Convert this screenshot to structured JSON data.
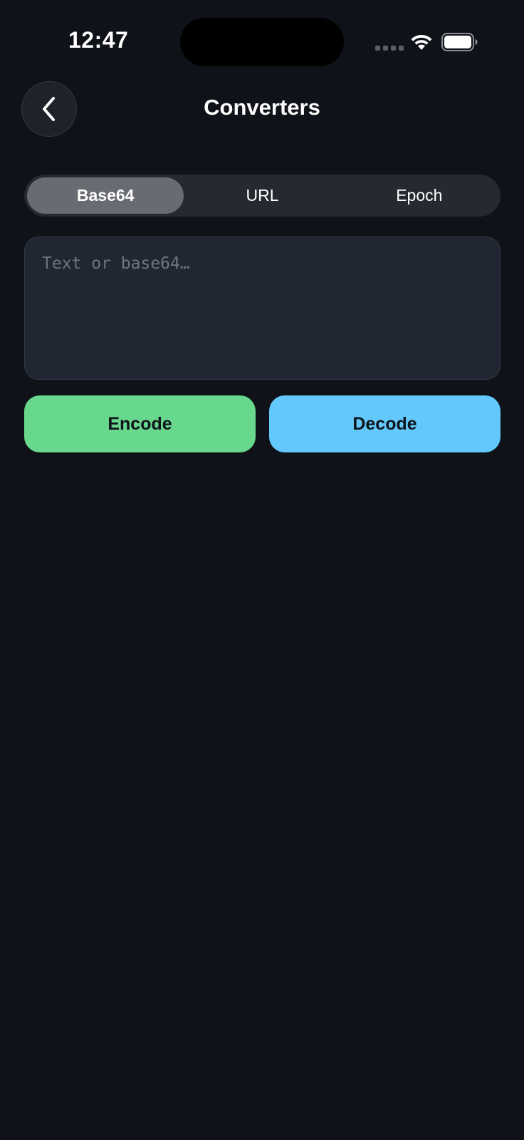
{
  "status_bar": {
    "time": "12:47"
  },
  "header": {
    "title": "Converters",
    "back_icon": "chevron-left-icon"
  },
  "tabs": [
    {
      "label": "Base64",
      "selected": true
    },
    {
      "label": "URL",
      "selected": false
    },
    {
      "label": "Epoch",
      "selected": false
    }
  ],
  "input": {
    "value": "",
    "placeholder": "Text or base64…"
  },
  "actions": {
    "encode_label": "Encode",
    "decode_label": "Decode"
  },
  "colors": {
    "background": "#0f1218",
    "encode": "#68d88d",
    "decode": "#63c8fc",
    "selected_tab": "#686b72"
  }
}
